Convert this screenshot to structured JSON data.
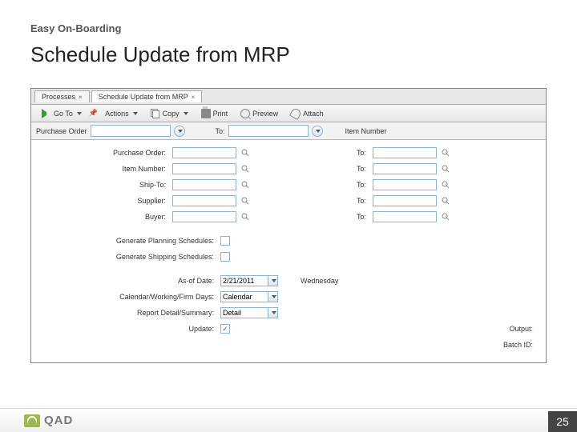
{
  "header": {
    "breadcrumb": "Easy On-Boarding",
    "title": "Schedule Update from MRP"
  },
  "tabs": [
    {
      "label": "Processes"
    },
    {
      "label": "Schedule Update from MRP"
    }
  ],
  "toolbar": {
    "goto": "Go To",
    "actions": "Actions",
    "copy": "Copy",
    "print": "Print",
    "preview": "Preview",
    "attach": "Attach"
  },
  "filterbar": {
    "po_label": "Purchase Order",
    "to_label": "To:",
    "item_label": "Item Number"
  },
  "form": {
    "rows": [
      {
        "label": "Purchase Order:",
        "to": "To:"
      },
      {
        "label": "Item Number:",
        "to": "To:"
      },
      {
        "label": "Ship-To:",
        "to": "To:"
      },
      {
        "label": "Supplier:",
        "to": "To:"
      },
      {
        "label": "Buyer:",
        "to": "To:"
      }
    ],
    "gen_planning": "Generate Planning Schedules:",
    "gen_shipping": "Generate Shipping Schedules:",
    "asof_label": "As-of Date:",
    "asof_value": "2/21/2011",
    "asof_day": "Wednesday",
    "cal_label": "Calendar/Working/Firm Days:",
    "cal_value": "Calendar",
    "report_label": "Report Detail/Summary:",
    "report_value": "Detail",
    "update_label": "Update:",
    "update_checked": "✓",
    "output": "Output:",
    "batch": "Batch ID:"
  },
  "footer": {
    "brand": "QAD",
    "page": "25"
  }
}
